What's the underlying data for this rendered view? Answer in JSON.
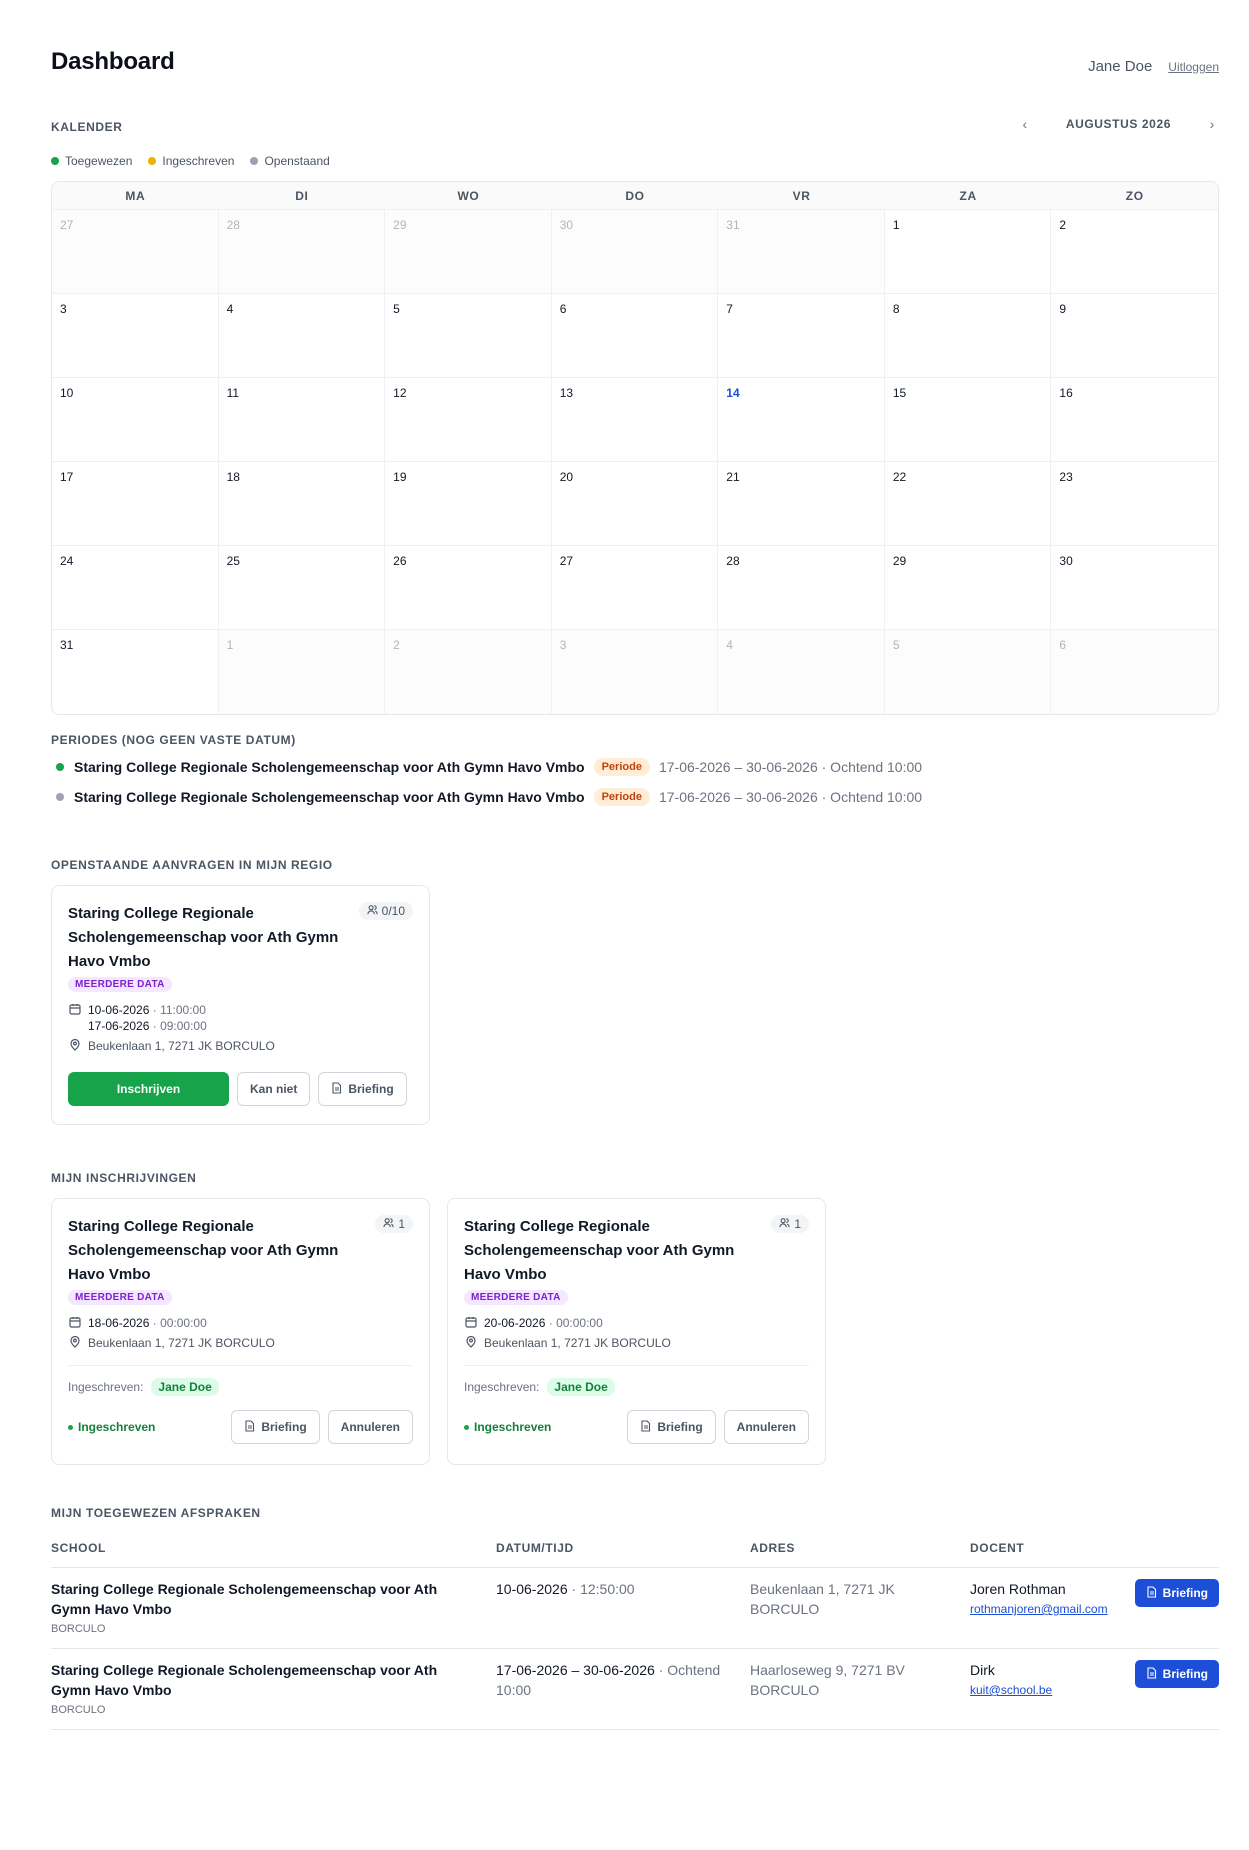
{
  "header": {
    "title": "Dashboard",
    "user_name": "Jane Doe",
    "logout_label": "Uitloggen"
  },
  "calendar": {
    "label": "KALENDER",
    "month": "AUGUSTUS 2026",
    "prev_icon": "‹",
    "next_icon": "›",
    "legend": [
      {
        "label": "Toegewezen",
        "color": "#16a34a"
      },
      {
        "label": "Ingeschreven",
        "color": "#eab308"
      },
      {
        "label": "Openstaand",
        "color": "#9ca3af"
      }
    ],
    "weekdays": [
      "MA",
      "DI",
      "WO",
      "DO",
      "VR",
      "ZA",
      "ZO"
    ],
    "days": [
      "27",
      "28",
      "29",
      "30",
      "31",
      "1",
      "2",
      "3",
      "4",
      "5",
      "6",
      "7",
      "8",
      "9",
      "10",
      "11",
      "12",
      "13",
      "14",
      "15",
      "16",
      "17",
      "18",
      "19",
      "20",
      "21",
      "22",
      "23",
      "24",
      "25",
      "26",
      "27",
      "28",
      "29",
      "30",
      "31",
      "1",
      "2",
      "3",
      "4",
      "5",
      "6"
    ],
    "today": "14"
  },
  "periods": {
    "label": "PERIODES (NOG GEEN VASTE DATUM)",
    "items": [
      {
        "school": "Staring College Regionale Scholengemeenschap voor Ath Gymn Havo Vmbo",
        "badge": "Periode",
        "range": "17-06-2026 – 30-06-2026 · Ochtend 10:00",
        "dot": "#16a34a"
      },
      {
        "school": "Staring College Regionale Scholengemeenschap voor Ath Gymn Havo Vmbo",
        "badge": "Periode",
        "range": "17-06-2026 – 30-06-2026 · Ochtend 10:00",
        "dot": "#9ca3af"
      }
    ]
  },
  "open_requests": {
    "label": "OPENSTAANDE AANVRAGEN IN MIJN REGIO",
    "card": {
      "title": "Staring College Regionale Scholengemeenschap voor Ath Gymn Havo Vmbo",
      "count": "0/10",
      "tag": "MEERDERE DATA",
      "date1": "10-06-2026",
      "time1": "· 11:00:00",
      "date2": "17-06-2026",
      "time2": "· 09:00:00",
      "address": "Beukenlaan 1, 7271 JK BORCULO",
      "btn_signup": "Inschrijven",
      "btn_cannot": "Kan niet",
      "btn_briefing": "Briefing"
    }
  },
  "my_enrollments": {
    "label": "MIJN INSCHRIJVINGEN",
    "cards": [
      {
        "title": "Staring College Regionale Scholengemeenschap voor Ath Gymn Havo Vmbo",
        "count": "1",
        "tag": "MEERDERE DATA",
        "date": "18-06-2026",
        "time": "· 00:00:00",
        "address": "Beukenlaan 1, 7271 JK BORCULO",
        "enrolled_label": "Ingeschreven:",
        "enrolled_name": "Jane Doe",
        "status": "Ingeschreven",
        "btn_briefing": "Briefing",
        "btn_cancel": "Annuleren"
      },
      {
        "title": "Staring College Regionale Scholengemeenschap voor Ath Gymn Havo Vmbo",
        "count": "1",
        "tag": "MEERDERE DATA",
        "date": "20-06-2026",
        "time": "· 00:00:00",
        "address": "Beukenlaan 1, 7271 JK BORCULO",
        "enrolled_label": "Ingeschreven:",
        "enrolled_name": "Jane Doe",
        "status": "Ingeschreven",
        "btn_briefing": "Briefing",
        "btn_cancel": "Annuleren"
      }
    ]
  },
  "appointments": {
    "label": "MIJN TOEGEWEZEN AFSPRAKEN",
    "columns": [
      "SCHOOL",
      "DATUM/TIJD",
      "ADRES",
      "DOCENT"
    ],
    "rows": [
      {
        "school": "Staring College Regionale Scholengemeenschap voor Ath Gymn Havo Vmbo",
        "city": "BORCULO",
        "date": "10-06-2026",
        "time": "· 12:50:00",
        "address": "Beukenlaan 1, 7271 JK BORCULO",
        "teacher": "Joren Rothman",
        "email": "rothmanjoren@gmail.com",
        "btn": "Briefing"
      },
      {
        "school": "Staring College Regionale Scholengemeenschap voor Ath Gymn Havo Vmbo",
        "city": "BORCULO",
        "date": "17-06-2026 – 30-06-2026",
        "time": "· Ochtend 10:00",
        "address": "Haarloseweg 9, 7271 BV BORCULO",
        "teacher": "Dirk",
        "email": "kuit@school.be",
        "btn": "Briefing"
      }
    ]
  },
  "colors": {
    "accent_green": "#16a34a",
    "accent_blue": "#1d4ed8",
    "badge_orange": "#c2410c",
    "tag_purple": "#7e22ce"
  }
}
